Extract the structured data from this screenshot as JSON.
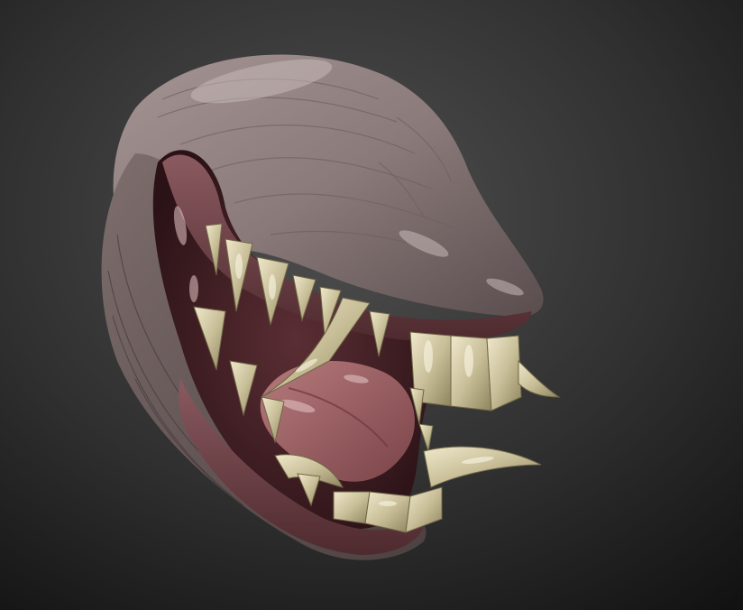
{
  "scene": {
    "subject": "creature-head-sculpt",
    "colors": {
      "background_top": "#4a4a4a",
      "background_bottom": "#121212",
      "skin": "#8c7c7c",
      "skin_dark": "#5f5252",
      "skin_highlight": "#b3a5a5",
      "gum": "#7a4a50",
      "gum_dark": "#4a2428",
      "mouth_interior": "#3a1e22",
      "tongue": "#a0686c",
      "tooth": "#c8bf9a",
      "tooth_shadow": "#8f8663",
      "tooth_highlight": "#ede6c8"
    }
  }
}
